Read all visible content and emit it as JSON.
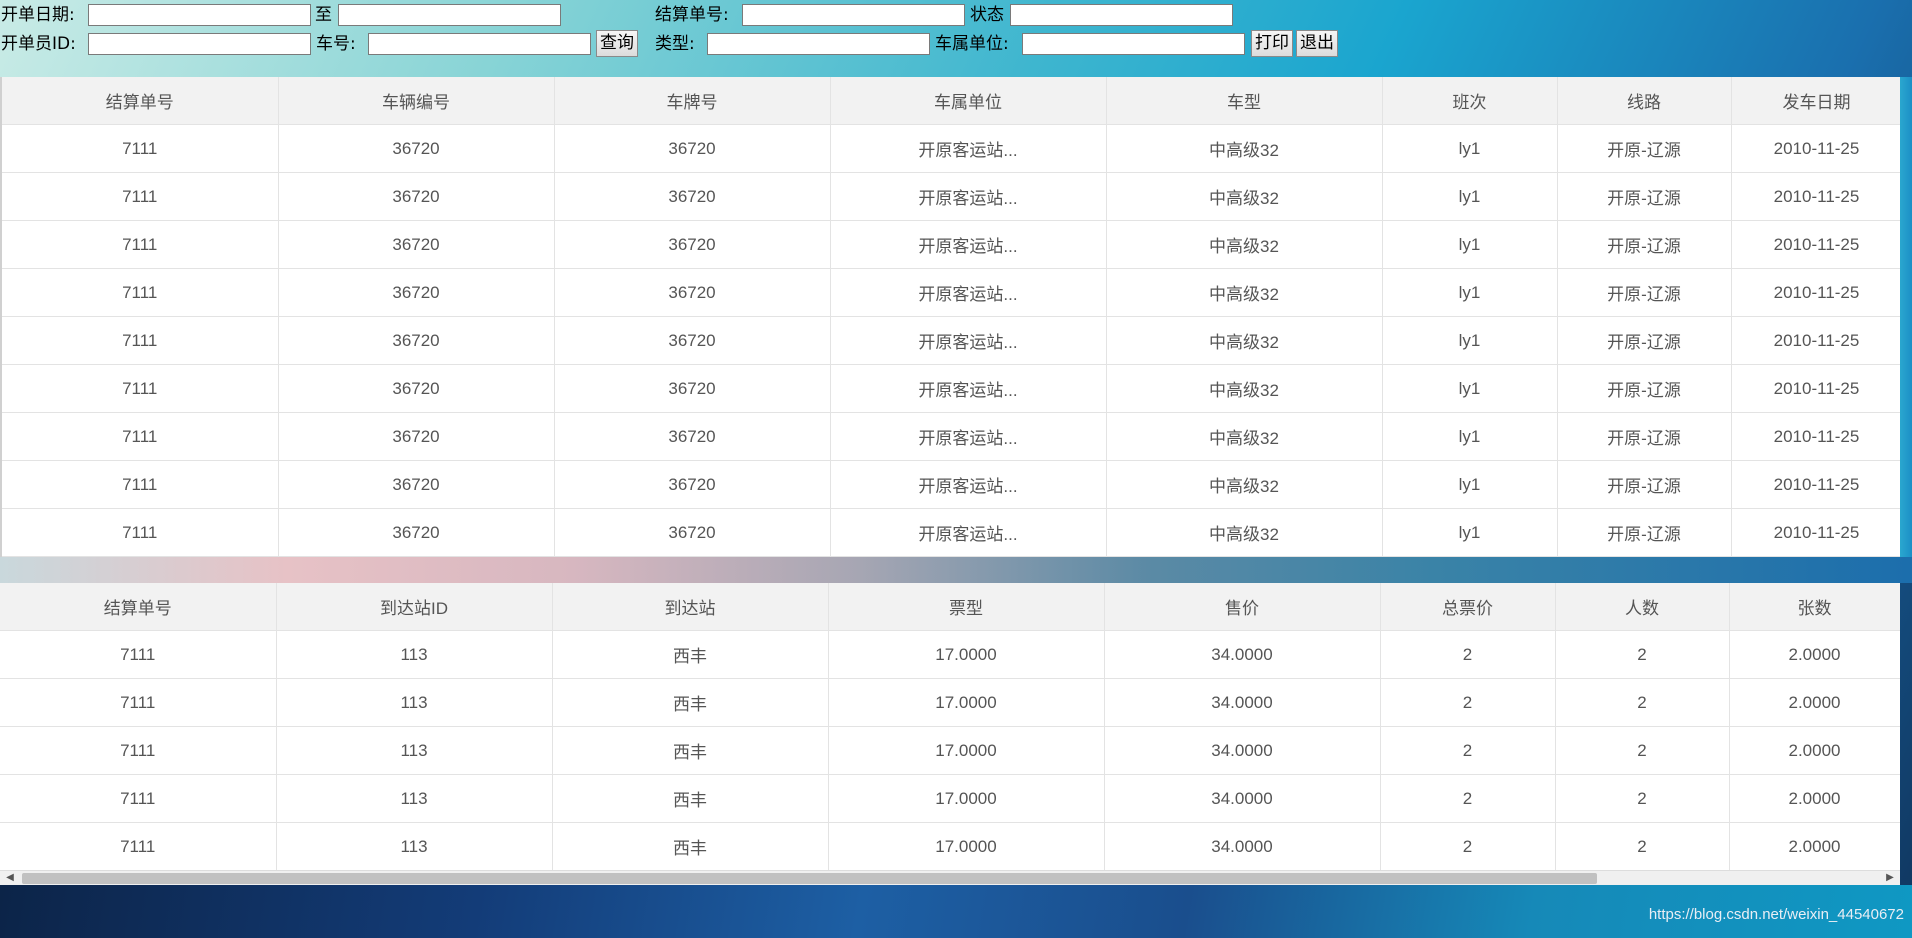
{
  "toolbar": {
    "start_date_label": "开单日期:",
    "to_label": "至",
    "settlement_no_label": "结算单号:",
    "status_label": "状态",
    "operator_id_label": "开单员ID:",
    "vehicle_no_label": "车号:",
    "query_button": "查询",
    "type_label": "类型:",
    "vehicle_unit_label": "车属单位:",
    "print_button": "打印",
    "exit_button": "退出",
    "start_date_value": "",
    "end_date_value": "",
    "settlement_no_value": "",
    "status_value": "",
    "operator_id_value": "",
    "vehicle_no_value": "",
    "type_value": "",
    "vehicle_unit_value": ""
  },
  "grid1": {
    "columns": [
      "结算单号",
      "车辆编号",
      "车牌号",
      "车属单位",
      "车型",
      "班次",
      "线路",
      "发车日期"
    ],
    "rows": [
      [
        "7111",
        "36720",
        "36720",
        "开原客运站...",
        "中高级32",
        "ly1",
        "开原-辽源",
        "2010-11-25"
      ],
      [
        "7111",
        "36720",
        "36720",
        "开原客运站...",
        "中高级32",
        "ly1",
        "开原-辽源",
        "2010-11-25"
      ],
      [
        "7111",
        "36720",
        "36720",
        "开原客运站...",
        "中高级32",
        "ly1",
        "开原-辽源",
        "2010-11-25"
      ],
      [
        "7111",
        "36720",
        "36720",
        "开原客运站...",
        "中高级32",
        "ly1",
        "开原-辽源",
        "2010-11-25"
      ],
      [
        "7111",
        "36720",
        "36720",
        "开原客运站...",
        "中高级32",
        "ly1",
        "开原-辽源",
        "2010-11-25"
      ],
      [
        "7111",
        "36720",
        "36720",
        "开原客运站...",
        "中高级32",
        "ly1",
        "开原-辽源",
        "2010-11-25"
      ],
      [
        "7111",
        "36720",
        "36720",
        "开原客运站...",
        "中高级32",
        "ly1",
        "开原-辽源",
        "2010-11-25"
      ],
      [
        "7111",
        "36720",
        "36720",
        "开原客运站...",
        "中高级32",
        "ly1",
        "开原-辽源",
        "2010-11-25"
      ],
      [
        "7111",
        "36720",
        "36720",
        "开原客运站...",
        "中高级32",
        "ly1",
        "开原-辽源",
        "2010-11-25"
      ]
    ]
  },
  "grid2": {
    "columns": [
      "结算单号",
      "到达站ID",
      "到达站",
      "票型",
      "售价",
      "总票价",
      "人数",
      "张数"
    ],
    "rows": [
      [
        "7111",
        "113",
        "西丰",
        "17.0000",
        "34.0000",
        "2",
        "2",
        "2.0000"
      ],
      [
        "7111",
        "113",
        "西丰",
        "17.0000",
        "34.0000",
        "2",
        "2",
        "2.0000"
      ],
      [
        "7111",
        "113",
        "西丰",
        "17.0000",
        "34.0000",
        "2",
        "2",
        "2.0000"
      ],
      [
        "7111",
        "113",
        "西丰",
        "17.0000",
        "34.0000",
        "2",
        "2",
        "2.0000"
      ],
      [
        "7111",
        "113",
        "西丰",
        "17.0000",
        "34.0000",
        "2",
        "2",
        "2.0000"
      ]
    ]
  },
  "scrollbar": {
    "left_arrow": "◀",
    "right_arrow": "▶"
  },
  "watermark": "https://blog.csdn.net/weixin_44540672"
}
